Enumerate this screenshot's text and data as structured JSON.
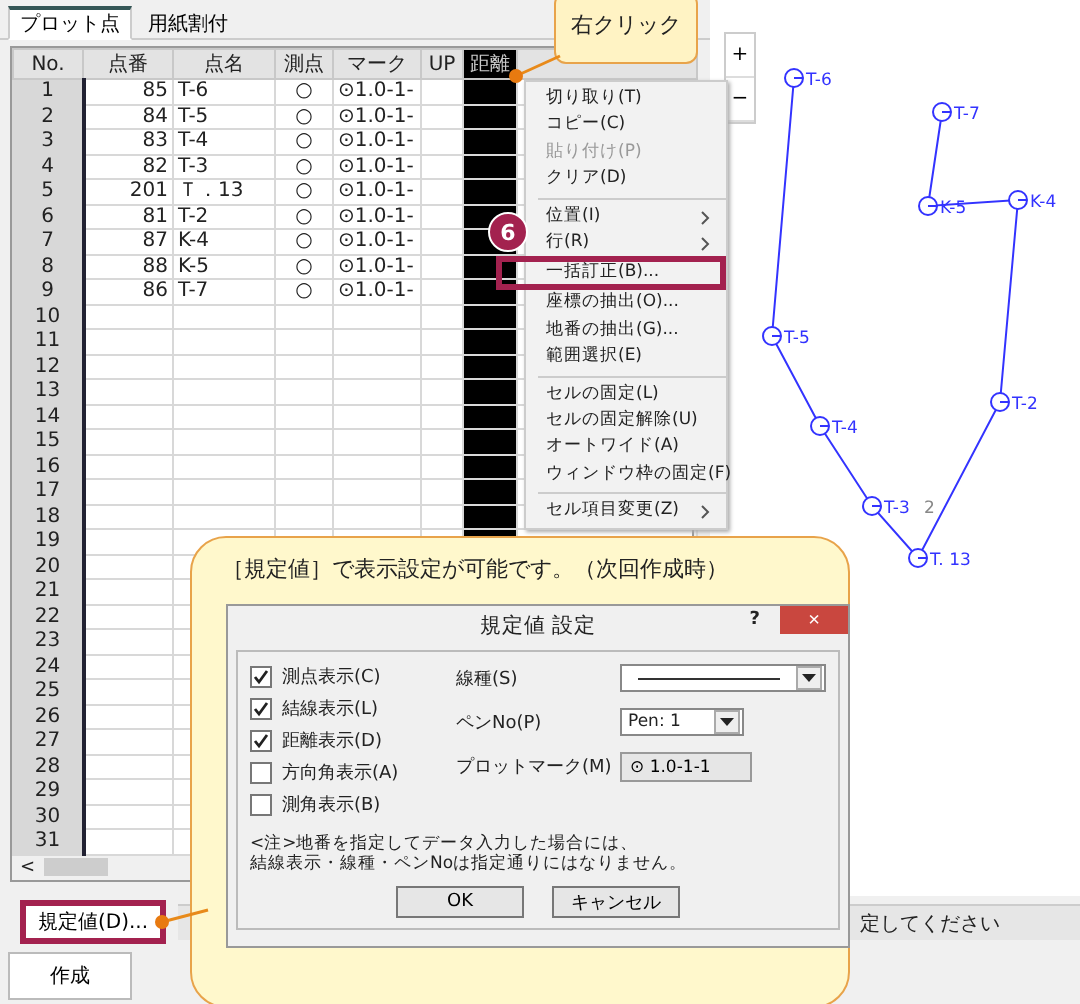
{
  "tabs": [
    {
      "label": "プロット点",
      "selected": true
    },
    {
      "label": "用紙割付",
      "selected": false
    }
  ],
  "grid": {
    "columns": [
      {
        "label": "No.",
        "selected": false
      },
      {
        "label": "点番",
        "selected": false
      },
      {
        "label": "点名",
        "selected": false
      },
      {
        "label": "測点",
        "selected": false
      },
      {
        "label": "マーク",
        "selected": false
      },
      {
        "label": "UP",
        "selected": false
      },
      {
        "label": "距離",
        "selected": true
      }
    ],
    "rows": [
      {
        "no": "1",
        "number": "85",
        "name": "T-6",
        "survey": "○",
        "mark": "⊙1.0-1-"
      },
      {
        "no": "2",
        "number": "84",
        "name": "T-5",
        "survey": "○",
        "mark": "⊙1.0-1-"
      },
      {
        "no": "3",
        "number": "83",
        "name": "T-4",
        "survey": "○",
        "mark": "⊙1.0-1-"
      },
      {
        "no": "4",
        "number": "82",
        "name": "T-3",
        "survey": "○",
        "mark": "⊙1.0-1-"
      },
      {
        "no": "5",
        "number": "201",
        "name": "Ｔ．13",
        "survey": "○",
        "mark": "⊙1.0-1-"
      },
      {
        "no": "6",
        "number": "81",
        "name": "T-2",
        "survey": "○",
        "mark": "⊙1.0-1-"
      },
      {
        "no": "7",
        "number": "87",
        "name": "K-4",
        "survey": "○",
        "mark": "⊙1.0-1-"
      },
      {
        "no": "8",
        "number": "88",
        "name": "K-5",
        "survey": "○",
        "mark": "⊙1.0-1-"
      },
      {
        "no": "9",
        "number": "86",
        "name": "T-7",
        "survey": "○",
        "mark": "⊙1.0-1-"
      },
      {
        "no": "10"
      },
      {
        "no": "11"
      },
      {
        "no": "12"
      },
      {
        "no": "13"
      },
      {
        "no": "14"
      },
      {
        "no": "15"
      },
      {
        "no": "16"
      },
      {
        "no": "17"
      },
      {
        "no": "18"
      },
      {
        "no": "19"
      },
      {
        "no": "20"
      },
      {
        "no": "21"
      },
      {
        "no": "22"
      },
      {
        "no": "23"
      },
      {
        "no": "24"
      },
      {
        "no": "25"
      },
      {
        "no": "26"
      },
      {
        "no": "27"
      },
      {
        "no": "28"
      },
      {
        "no": "29"
      },
      {
        "no": "30"
      },
      {
        "no": "31"
      }
    ]
  },
  "scroll_left": "<",
  "defaults_button": "規定値(D)...",
  "create_button": "作成",
  "status_bar": "定してください",
  "zoom_buttons": [
    "+",
    "−"
  ],
  "context_menu": [
    {
      "kind": "item",
      "label": "切り取り(T)",
      "disabled": false,
      "highlighted": false
    },
    {
      "kind": "item",
      "label": "コピー(C)",
      "disabled": false,
      "highlighted": false
    },
    {
      "kind": "item",
      "label": "貼り付け(P)",
      "disabled": true,
      "highlighted": false
    },
    {
      "kind": "item",
      "label": "クリア(D)",
      "disabled": false,
      "highlighted": false
    },
    {
      "kind": "separator"
    },
    {
      "kind": "submenu",
      "label": "位置(I)",
      "disabled": false,
      "highlighted": false
    },
    {
      "kind": "submenu",
      "label": "行(R)",
      "disabled": false,
      "highlighted": false
    },
    {
      "kind": "item",
      "label": "一括訂正(B)...",
      "disabled": false,
      "highlighted": true
    },
    {
      "kind": "item",
      "label": "座標の抽出(O)...",
      "disabled": false,
      "highlighted": false
    },
    {
      "kind": "item",
      "label": "地番の抽出(G)...",
      "disabled": false,
      "highlighted": false
    },
    {
      "kind": "item",
      "label": "範囲選択(E)",
      "disabled": false,
      "highlighted": false
    },
    {
      "kind": "separator"
    },
    {
      "kind": "item",
      "label": "セルの固定(L)",
      "disabled": false,
      "highlighted": false
    },
    {
      "kind": "item",
      "label": "セルの固定解除(U)",
      "disabled": false,
      "highlighted": false
    },
    {
      "kind": "item",
      "label": "オートワイド(A)",
      "disabled": false,
      "highlighted": false
    },
    {
      "kind": "item",
      "label": "ウィンドウ枠の固定(F)",
      "disabled": false,
      "highlighted": false
    },
    {
      "kind": "separator"
    },
    {
      "kind": "submenu",
      "label": "セル項目変更(Z)",
      "disabled": false,
      "highlighted": false
    }
  ],
  "plot": {
    "points": [
      "T-6",
      "T-5",
      "T-4",
      "T-3",
      "T. 13",
      "T-2",
      "K-4",
      "K-5",
      "T-7"
    ],
    "distance_label": "2"
  },
  "step_badge": "6",
  "callout_right_click": "右クリック",
  "callout_note": "［規定値］で表示設定が可能です。（次回作成時）",
  "dialog": {
    "title": "規定値 設定",
    "help": "?",
    "close": "×",
    "checkboxes": [
      {
        "label": "測点表示(C)",
        "checked": true
      },
      {
        "label": "結線表示(L)",
        "checked": true
      },
      {
        "label": "距離表示(D)",
        "checked": true
      },
      {
        "label": "方向角表示(A)",
        "checked": false
      },
      {
        "label": "測角表示(B)",
        "checked": false
      }
    ],
    "line_type_label": "線種(S)",
    "pen_label": "ペンNo(P)",
    "pen_value": "Pen: 1",
    "mark_label": "プロットマーク(M)",
    "mark_value": "⊙ 1.0-1-1",
    "note": [
      "<注>地番を指定してデータ入力した場合には、",
      "結線表示・線種・ペンNoは指定通りにはなりません。"
    ],
    "buttons": [
      "OK",
      "キャンセル"
    ]
  }
}
